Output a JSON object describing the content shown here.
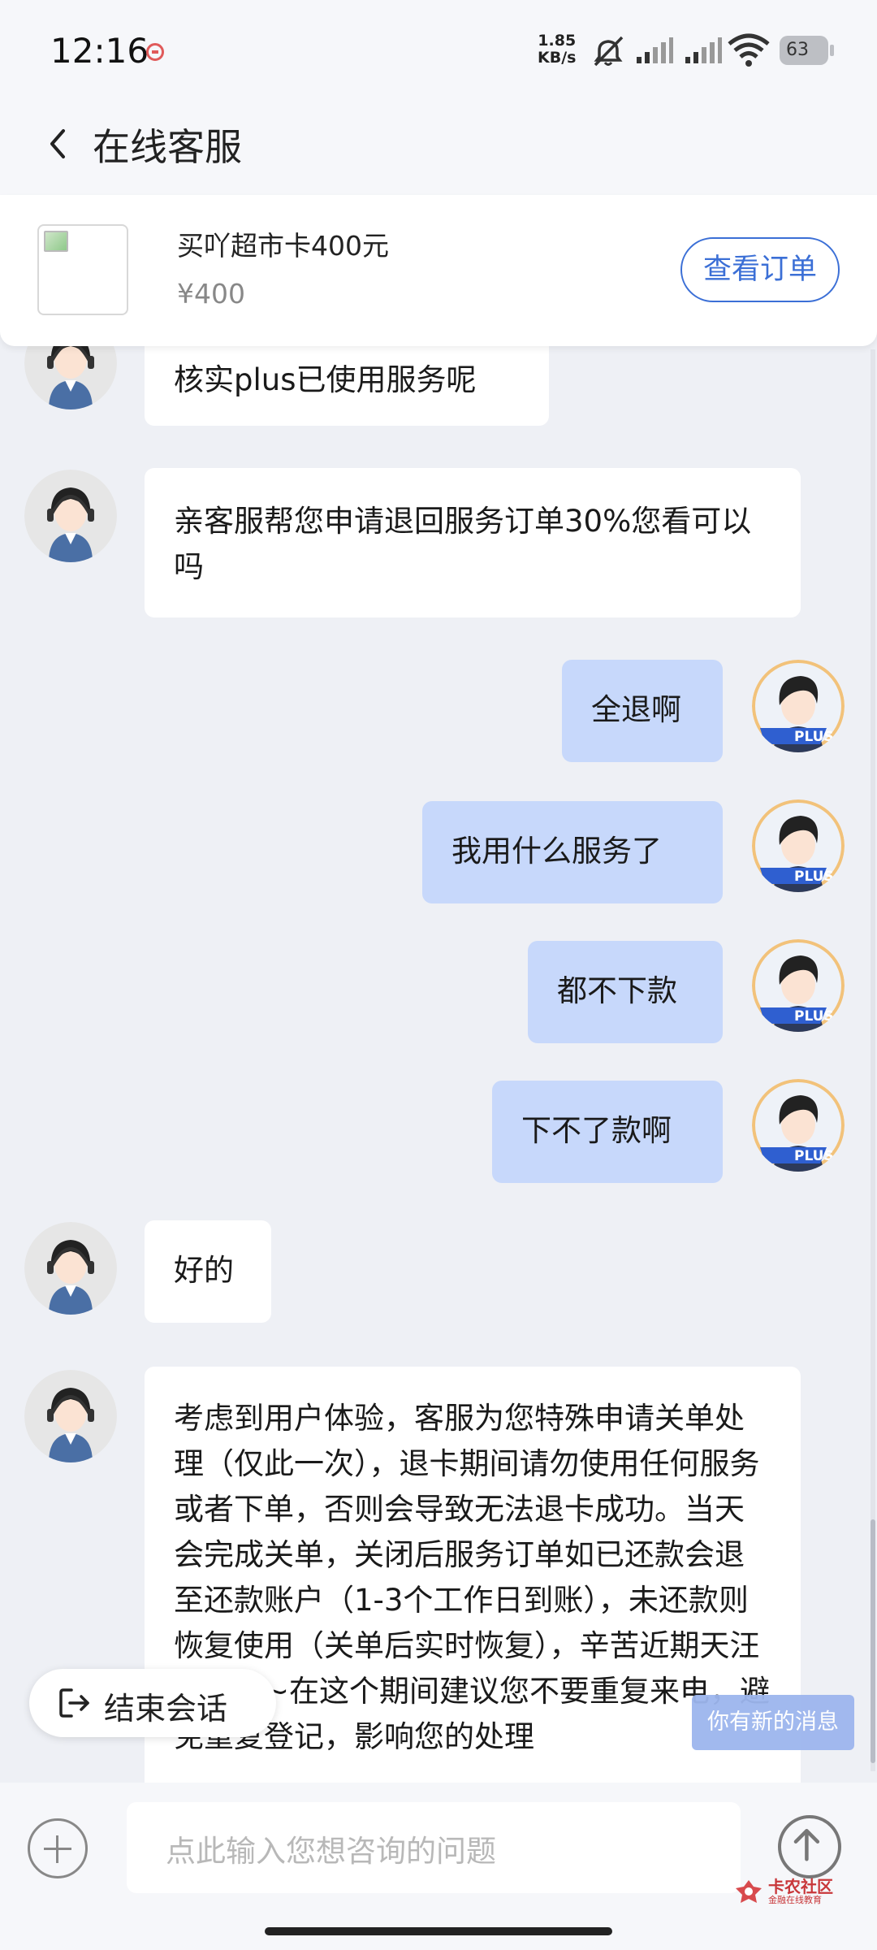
{
  "status_bar": {
    "time": "12:16",
    "speed_value": "1.85",
    "speed_unit": "KB/s",
    "battery": "63"
  },
  "header": {
    "title": "在线客服"
  },
  "order": {
    "name": "买吖超市卡400元",
    "price": "¥400",
    "view_button": "查看订单"
  },
  "messages": [
    {
      "from": "agent",
      "text": "核实plus已使用服务呢"
    },
    {
      "from": "agent",
      "text": "亲客服帮您申请退回服务订单30%您看可以吗"
    },
    {
      "from": "user",
      "text": "全退啊"
    },
    {
      "from": "user",
      "text": "我用什么服务了"
    },
    {
      "from": "user",
      "text": "都不下款"
    },
    {
      "from": "user",
      "text": "下不了款啊"
    },
    {
      "from": "agent",
      "text": "好的"
    },
    {
      "from": "agent",
      "text": "考虑到用户体验，客服为您特殊申请关单处理（仅此一次），退卡期间请勿使用任何服务或者下单，否则会导致无法退卡成功。当天会完成关单，关闭后服务订单如已还款会退至还款账户（1-3个工作日到账），未还款则恢复使用（关单后实时恢复），辛苦近期天汪一下哦~在这个期间建议您不要重复来电，避免重复登记，影响您的处理"
    }
  ],
  "user_badge": "PLUS",
  "end_chat": "结束会话",
  "new_message": "你有新的消息",
  "input": {
    "placeholder": "点此输入您想咨询的问题"
  },
  "watermark": {
    "name": "卡农社区",
    "sub": "金融在线教育"
  },
  "colors": {
    "accent": "#3b6fd6",
    "user_bubble": "#c7d8fb",
    "agent_bubble": "#ffffff",
    "background": "#eef0f5"
  }
}
